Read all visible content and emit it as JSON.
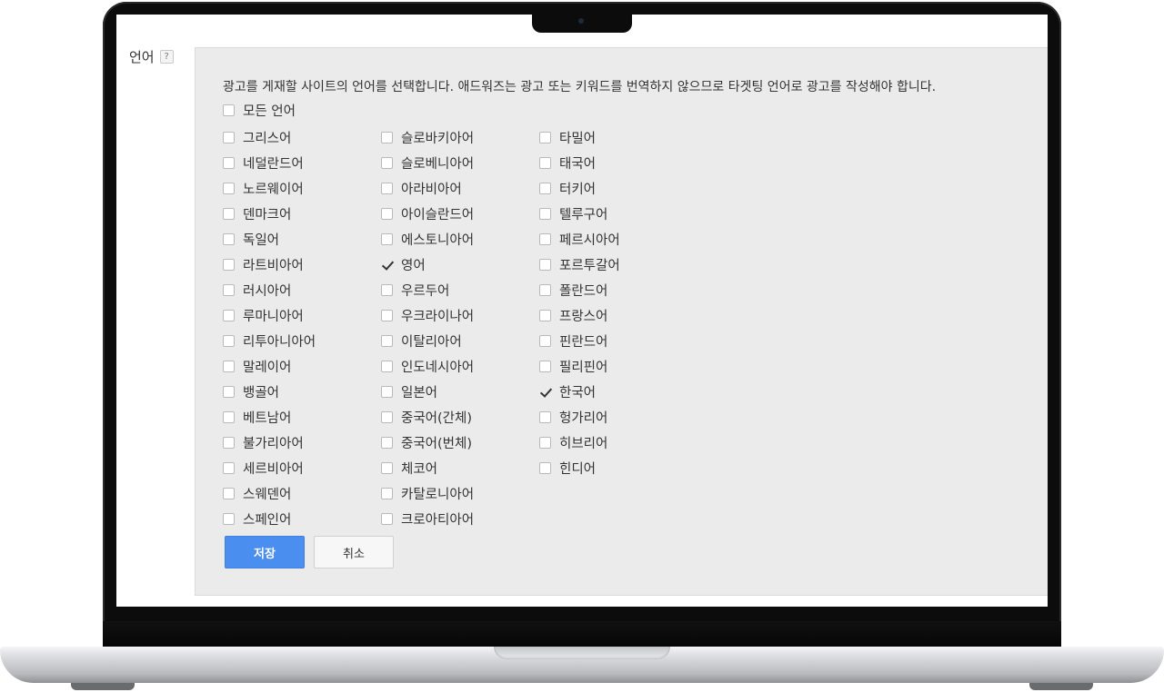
{
  "section": {
    "label": "언어",
    "help": "?"
  },
  "instruction": "광고를 게재할 사이트의 언어를 선택합니다. 애드워즈는 광고 또는 키워드를 번역하지 않으므로 타겟팅 언어로 광고를 작성해야 합니다.",
  "all_languages": {
    "label": "모든 언어",
    "checked": false
  },
  "columns": [
    [
      {
        "label": "그리스어",
        "checked": false
      },
      {
        "label": "네덜란드어",
        "checked": false
      },
      {
        "label": "노르웨이어",
        "checked": false
      },
      {
        "label": "덴마크어",
        "checked": false
      },
      {
        "label": "독일어",
        "checked": false
      },
      {
        "label": "라트비아어",
        "checked": false
      },
      {
        "label": "러시아어",
        "checked": false
      },
      {
        "label": "루마니아어",
        "checked": false
      },
      {
        "label": "리투아니아어",
        "checked": false
      },
      {
        "label": "말레이어",
        "checked": false
      },
      {
        "label": "뱅골어",
        "checked": false
      },
      {
        "label": "베트남어",
        "checked": false
      },
      {
        "label": "불가리아어",
        "checked": false
      },
      {
        "label": "세르비아어",
        "checked": false
      },
      {
        "label": "스웨덴어",
        "checked": false
      },
      {
        "label": "스페인어",
        "checked": false
      }
    ],
    [
      {
        "label": "슬로바키아어",
        "checked": false
      },
      {
        "label": "슬로베니아어",
        "checked": false
      },
      {
        "label": "아라비아어",
        "checked": false
      },
      {
        "label": "아이슬란드어",
        "checked": false
      },
      {
        "label": "에스토니아어",
        "checked": false
      },
      {
        "label": "영어",
        "checked": true
      },
      {
        "label": "우르두어",
        "checked": false
      },
      {
        "label": "우크라이나어",
        "checked": false
      },
      {
        "label": "이탈리아어",
        "checked": false
      },
      {
        "label": "인도네시아어",
        "checked": false
      },
      {
        "label": "일본어",
        "checked": false
      },
      {
        "label": "중국어(간체)",
        "checked": false
      },
      {
        "label": "중국어(번체)",
        "checked": false
      },
      {
        "label": "체코어",
        "checked": false
      },
      {
        "label": "카탈로니아어",
        "checked": false
      },
      {
        "label": "크로아티아어",
        "checked": false
      }
    ],
    [
      {
        "label": "타밀어",
        "checked": false
      },
      {
        "label": "태국어",
        "checked": false
      },
      {
        "label": "터키어",
        "checked": false
      },
      {
        "label": "텔루구어",
        "checked": false
      },
      {
        "label": "페르시아어",
        "checked": false
      },
      {
        "label": "포르투갈어",
        "checked": false
      },
      {
        "label": "폴란드어",
        "checked": false
      },
      {
        "label": "프랑스어",
        "checked": false
      },
      {
        "label": "핀란드어",
        "checked": false
      },
      {
        "label": "필리핀어",
        "checked": false
      },
      {
        "label": "한국어",
        "checked": true
      },
      {
        "label": "헝가리어",
        "checked": false
      },
      {
        "label": "히브리어",
        "checked": false
      },
      {
        "label": "힌디어",
        "checked": false
      }
    ]
  ],
  "buttons": {
    "save": "저장",
    "cancel": "취소"
  },
  "colors": {
    "save_button": "#4a8ef0",
    "panel_background": "#ebebeb"
  }
}
